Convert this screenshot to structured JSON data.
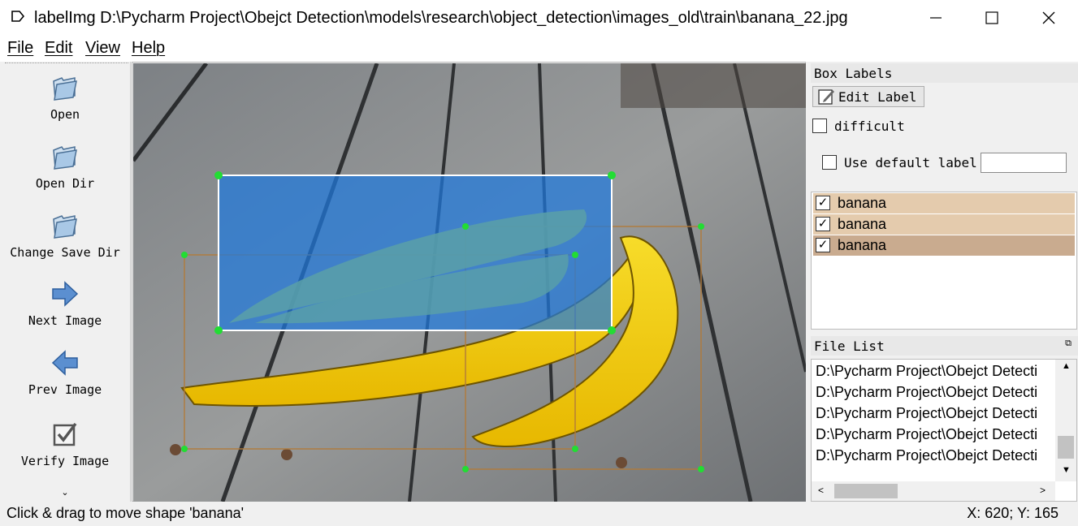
{
  "window": {
    "title": "labelImg D:\\Pycharm Project\\Obejct Detection\\models\\research\\object_detection\\images_old\\train\\banana_22.jpg",
    "minimize": "—",
    "maximize": "☐",
    "close": "✕"
  },
  "menu": [
    "File",
    "Edit",
    "View",
    "Help"
  ],
  "toolbar": {
    "items": [
      {
        "label": "Open",
        "icon": "folder-open-icon"
      },
      {
        "label": "Open Dir",
        "icon": "folder-open-icon"
      },
      {
        "label": "Change Save Dir",
        "icon": "folder-open-icon"
      },
      {
        "label": "Next Image",
        "icon": "arrow-right-icon"
      },
      {
        "label": "Prev Image",
        "icon": "arrow-left-icon"
      },
      {
        "label": "Verify Image",
        "icon": "checkbox-icon"
      }
    ],
    "more": "»"
  },
  "box_labels": {
    "title": "Box Labels",
    "edit_label": "Edit Label",
    "difficult": "difficult",
    "use_default_label": "Use default label",
    "default_label_value": "",
    "labels": [
      {
        "text": "banana",
        "checked": true,
        "selected": false
      },
      {
        "text": "banana",
        "checked": true,
        "selected": false
      },
      {
        "text": "banana",
        "checked": true,
        "selected": true
      }
    ]
  },
  "file_list": {
    "title": "File List",
    "files": [
      "D:\\Pycharm Project\\Obejct Detecti",
      "D:\\Pycharm Project\\Obejct Detecti",
      "D:\\Pycharm Project\\Obejct Detecti",
      "D:\\Pycharm Project\\Obejct Detecti",
      "D:\\Pycharm Project\\Obejct Detecti"
    ]
  },
  "status": {
    "message": "Click & drag to move shape 'banana'",
    "coords": "X: 620; Y: 165"
  },
  "colors": {
    "selected_box_fill": "#1e78dc",
    "box_outline": "#b07a3a",
    "handle": "#22dd33",
    "label_row": "#e4cbad",
    "label_row_selected": "#c9ab8f"
  }
}
